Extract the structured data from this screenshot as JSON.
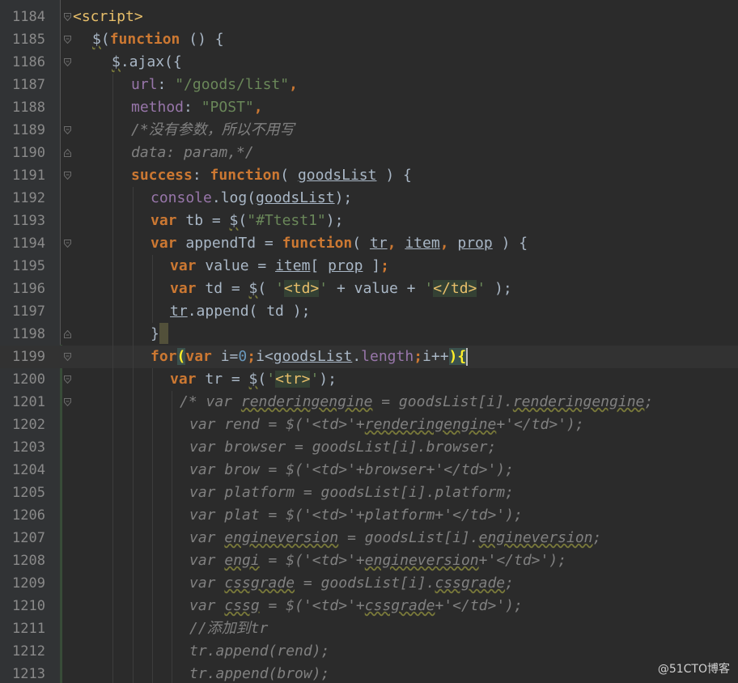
{
  "editor": {
    "lines": [
      {
        "num": "1184",
        "fold": "open",
        "indent": 0,
        "tokens": [
          [
            "tag",
            "<script>"
          ]
        ]
      },
      {
        "num": "1185",
        "fold": "open",
        "indent": 1,
        "tokens": [
          [
            "wavy",
            "$"
          ],
          [
            "plain",
            "("
          ],
          [
            "kw",
            "function"
          ],
          [
            "plain",
            " () {"
          ]
        ]
      },
      {
        "num": "1186",
        "fold": "open",
        "indent": 2,
        "tokens": [
          [
            "wavy",
            "$"
          ],
          [
            "plain",
            ".ajax({"
          ]
        ]
      },
      {
        "num": "1187",
        "fold": "",
        "indent": 3,
        "tokens": [
          [
            "prop",
            "url"
          ],
          [
            "plain",
            ": "
          ],
          [
            "str",
            "\"/goods/list\""
          ],
          [
            "kw",
            ","
          ]
        ]
      },
      {
        "num": "1188",
        "fold": "",
        "indent": 3,
        "tokens": [
          [
            "prop",
            "method"
          ],
          [
            "plain",
            ": "
          ],
          [
            "str",
            "\"POST\""
          ],
          [
            "kw",
            ","
          ]
        ]
      },
      {
        "num": "1189",
        "fold": "open",
        "indent": 3,
        "tokens": [
          [
            "cmt",
            "/*没有参数，所以不用写"
          ]
        ]
      },
      {
        "num": "1190",
        "fold": "close",
        "indent": 3,
        "tokens": [
          [
            "cmt",
            "data: param,*/"
          ]
        ]
      },
      {
        "num": "1191",
        "fold": "open",
        "indent": 3,
        "tokens": [
          [
            "kw",
            "success"
          ],
          [
            "plain",
            ": "
          ],
          [
            "kw",
            "function"
          ],
          [
            "plain",
            "( "
          ],
          [
            "ul",
            "goodsList"
          ],
          [
            "plain",
            " ) {"
          ]
        ]
      },
      {
        "num": "1192",
        "fold": "",
        "indent": 4,
        "tokens": [
          [
            "prop",
            "console"
          ],
          [
            "plain",
            ".log("
          ],
          [
            "ul",
            "goodsList"
          ],
          [
            "plain",
            ");"
          ]
        ]
      },
      {
        "num": "1193",
        "fold": "",
        "indent": 4,
        "tokens": [
          [
            "kw",
            "var"
          ],
          [
            "plain",
            " tb = "
          ],
          [
            "wavy",
            "$"
          ],
          [
            "plain",
            "("
          ],
          [
            "str",
            "\"#Ttest1\""
          ],
          [
            "plain",
            ");"
          ]
        ]
      },
      {
        "num": "1194",
        "fold": "open",
        "indent": 4,
        "tokens": [
          [
            "kw",
            "var"
          ],
          [
            "plain",
            " appendTd = "
          ],
          [
            "kw",
            "function"
          ],
          [
            "plain",
            "( "
          ],
          [
            "ul",
            "tr"
          ],
          [
            "kw",
            ","
          ],
          [
            "plain",
            " "
          ],
          [
            "ul",
            "item"
          ],
          [
            "kw",
            ","
          ],
          [
            "plain",
            " "
          ],
          [
            "ul",
            "prop"
          ],
          [
            "plain",
            " ) {"
          ]
        ]
      },
      {
        "num": "1195",
        "fold": "",
        "indent": 5,
        "tokens": [
          [
            "kw",
            "var"
          ],
          [
            "plain",
            " value = "
          ],
          [
            "ul",
            "item"
          ],
          [
            "plain",
            "[ "
          ],
          [
            "ul",
            "prop"
          ],
          [
            "plain",
            " ]"
          ],
          [
            "kw",
            ";"
          ]
        ]
      },
      {
        "num": "1196",
        "fold": "",
        "indent": 5,
        "tokens": [
          [
            "kw",
            "var"
          ],
          [
            "plain",
            " td = "
          ],
          [
            "wavy",
            "$"
          ],
          [
            "plain",
            "( "
          ],
          [
            "str",
            "'"
          ],
          [
            "htmltag",
            "<td>"
          ],
          [
            "str",
            "'"
          ],
          [
            "plain",
            " + value + "
          ],
          [
            "str",
            "'"
          ],
          [
            "htmltag",
            "</td>"
          ],
          [
            "str",
            "'"
          ],
          [
            "plain",
            " );"
          ]
        ]
      },
      {
        "num": "1197",
        "fold": "",
        "indent": 5,
        "tokens": [
          [
            "ul",
            "tr"
          ],
          [
            "plain",
            ".append( td );"
          ]
        ]
      },
      {
        "num": "1198",
        "fold": "close",
        "indent": 4,
        "tokens": [
          [
            "plain",
            "}"
          ],
          [
            "cursorblock",
            ""
          ]
        ]
      },
      {
        "num": "1199",
        "fold": "open",
        "indent": 4,
        "current": true,
        "tokens": [
          [
            "kw",
            "for"
          ],
          [
            "bracehl",
            "("
          ],
          [
            "kw",
            "var"
          ],
          [
            "plain",
            " i="
          ],
          [
            "num",
            "0"
          ],
          [
            "kw",
            ";"
          ],
          [
            "plain",
            "i<"
          ],
          [
            "ul",
            "goodsList"
          ],
          [
            "plain",
            "."
          ],
          [
            "prop",
            "length"
          ],
          [
            "kw",
            ";"
          ],
          [
            "plain",
            "i++"
          ],
          [
            "bracehl",
            ")"
          ],
          [
            "bracehl",
            "{"
          ],
          [
            "caret",
            ""
          ]
        ]
      },
      {
        "num": "1200",
        "fold": "open",
        "indent": 5,
        "tokens": [
          [
            "kw",
            "var"
          ],
          [
            "plain",
            " tr = "
          ],
          [
            "wavy",
            "$"
          ],
          [
            "plain",
            "("
          ],
          [
            "str",
            "'"
          ],
          [
            "htmltag",
            "<tr>"
          ],
          [
            "str",
            "'"
          ],
          [
            "plain",
            ");"
          ]
        ]
      },
      {
        "num": "1201",
        "fold": "open",
        "indent": 5.5,
        "tokens": [
          [
            "cmt",
            "/* var "
          ],
          [
            "cmtwavy",
            "renderingengine"
          ],
          [
            "cmt",
            " = goodsList[i]."
          ],
          [
            "cmtwavy",
            "renderingengine"
          ],
          [
            "cmt",
            ";"
          ]
        ]
      },
      {
        "num": "1202",
        "fold": "",
        "indent": 6,
        "tokens": [
          [
            "cmt",
            "var rend = $('<td>'+"
          ],
          [
            "cmtwavy",
            "renderingengine"
          ],
          [
            "cmt",
            "+'</td>');"
          ]
        ]
      },
      {
        "num": "1203",
        "fold": "",
        "indent": 6,
        "tokens": [
          [
            "cmt",
            "var browser = goodsList[i].browser;"
          ]
        ]
      },
      {
        "num": "1204",
        "fold": "",
        "indent": 6,
        "tokens": [
          [
            "cmt",
            "var brow = $('<td>'+browser+'</td>');"
          ]
        ]
      },
      {
        "num": "1205",
        "fold": "",
        "indent": 6,
        "tokens": [
          [
            "cmt",
            "var platform = goodsList[i].platform;"
          ]
        ]
      },
      {
        "num": "1206",
        "fold": "",
        "indent": 6,
        "tokens": [
          [
            "cmt",
            "var plat = $('<td>'+platform+'</td>');"
          ]
        ]
      },
      {
        "num": "1207",
        "fold": "",
        "indent": 6,
        "tokens": [
          [
            "cmt",
            "var "
          ],
          [
            "cmtwavy",
            "engineversion"
          ],
          [
            "cmt",
            " = goodsList[i]."
          ],
          [
            "cmtwavy",
            "engineversion"
          ],
          [
            "cmt",
            ";"
          ]
        ]
      },
      {
        "num": "1208",
        "fold": "",
        "indent": 6,
        "tokens": [
          [
            "cmt",
            "var "
          ],
          [
            "cmtwavy",
            "engi"
          ],
          [
            "cmt",
            " = $('<td>'+"
          ],
          [
            "cmtwavy",
            "engineversion"
          ],
          [
            "cmt",
            "+'</td>');"
          ]
        ]
      },
      {
        "num": "1209",
        "fold": "",
        "indent": 6,
        "tokens": [
          [
            "cmt",
            "var "
          ],
          [
            "cmtwavy",
            "cssgrade"
          ],
          [
            "cmt",
            " = goodsList[i]."
          ],
          [
            "cmtwavy",
            "cssgrade"
          ],
          [
            "cmt",
            ";"
          ]
        ]
      },
      {
        "num": "1210",
        "fold": "",
        "indent": 6,
        "tokens": [
          [
            "cmt",
            "var "
          ],
          [
            "cmtwavy",
            "cssg"
          ],
          [
            "cmt",
            " = $('<td>'+"
          ],
          [
            "cmtwavy",
            "cssgrade"
          ],
          [
            "cmt",
            "+'</td>');"
          ]
        ]
      },
      {
        "num": "1211",
        "fold": "",
        "indent": 6,
        "tokens": [
          [
            "cmt",
            "//添加到tr"
          ]
        ]
      },
      {
        "num": "1212",
        "fold": "",
        "indent": 6,
        "tokens": [
          [
            "cmt",
            "tr.append(rend);"
          ]
        ]
      },
      {
        "num": "1213",
        "fold": "",
        "indent": 6,
        "tokens": [
          [
            "cmt",
            "tr.append(brow);"
          ]
        ]
      }
    ]
  },
  "watermark": "@51CTO博客",
  "colors": {
    "background": "#2b2b2b",
    "gutter": "#313335",
    "keyword": "#cc7832",
    "string": "#6a8759",
    "comment": "#808080",
    "property": "#9876aa",
    "tag": "#e8bf6a",
    "plain": "#a9b7c6",
    "number": "#6897bb"
  },
  "icons": {
    "fold_open": "fold-open-icon",
    "fold_close": "fold-close-icon"
  }
}
